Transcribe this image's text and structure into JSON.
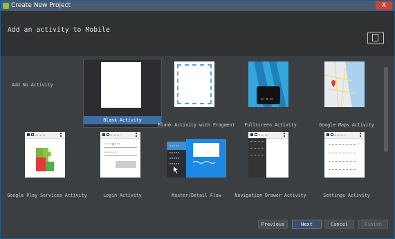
{
  "window": {
    "title": "Create New Project",
    "close_label": "X"
  },
  "header": {
    "heading": "Add an activity to Mobile"
  },
  "gallery": {
    "items": [
      {
        "label": "Add No Activity"
      },
      {
        "label": "Blank Activity",
        "selected": true
      },
      {
        "label": "Blank Activity with Fragment"
      },
      {
        "label": "Fullscreen Activity"
      },
      {
        "label": "Google Maps Activity"
      },
      {
        "label": "Google Play Services Activity"
      },
      {
        "label": "Login Activity"
      },
      {
        "label": "Master/Detail Flow"
      },
      {
        "label": "Navigation Drawer Activity"
      },
      {
        "label": "Settings Activity"
      }
    ]
  },
  "footer": {
    "previous": "Previous",
    "next": "Next",
    "cancel": "Cancel",
    "finish": "Finish"
  },
  "colors": {
    "selection": "#3d6fa6",
    "titlebar": "#4a5a72",
    "dialog_bg": "#3c3f41"
  }
}
